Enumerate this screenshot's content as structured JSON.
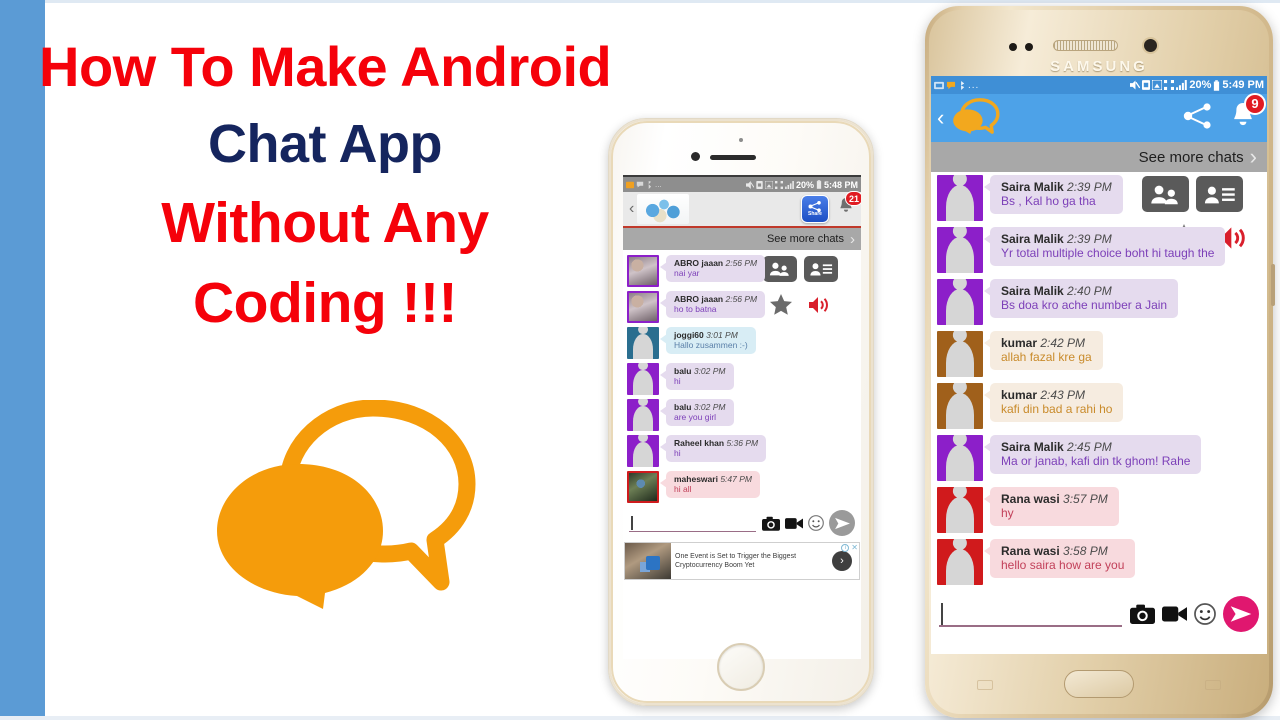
{
  "colors": {
    "accent_blue_bar": "#5b9bd5",
    "title_red": "#f5010a",
    "title_navy": "#15255e",
    "logo_orange": "#f59c0b",
    "appbar_blue": "#4da2e8",
    "badge_red": "#e01b22",
    "seemore_gray": "#a8a8a8",
    "send_pink": "#e0176f"
  },
  "title": {
    "line1": "How To Make Android",
    "line2": "Chat App",
    "line3": "Without Any",
    "line4": "Coding !!!"
  },
  "logo": {
    "icon": "chat-bubbles-icon"
  },
  "iphone": {
    "device_name": "iphone-gold",
    "status_bar": {
      "left_icons": [
        "screenshot-icon",
        "chat-icon",
        "bluetooth-icon",
        "more-icon"
      ],
      "right_icons": [
        "mute-icon",
        "sim-icon",
        "signal-card-icon",
        "wifi-icon",
        "signal-bars-icon",
        "battery-icon"
      ],
      "battery_text": "20%",
      "clock": "5:48 PM"
    },
    "appbar": {
      "back_icon": "back-chevron-icon",
      "logo_icon": "smurfs-avatar-icon",
      "share_label": "Share",
      "share_icon": "share-icon",
      "bell_icon": "bell-icon",
      "bell_badge": "21"
    },
    "see_more": {
      "label": "See more chats",
      "chevron": "chevron-right-icon"
    },
    "overlay": {
      "group_icon": "group-people-icon",
      "contact_icon": "contact-card-icon",
      "star_icon": "star-icon",
      "speaker_icon": "speaker-loud-icon"
    },
    "messages": [
      {
        "name": "ABRO jaaan",
        "time": "2:56 PM",
        "text": "nai yar",
        "theme": "th-purple",
        "avatar": "photo"
      },
      {
        "name": "ABRO jaaan",
        "time": "2:56 PM",
        "text": "ho to batna",
        "theme": "th-purple",
        "avatar": "photo"
      },
      {
        "name": "joggi60",
        "time": "3:01 PM",
        "text": "Hallo zusammen :-)",
        "theme": "th-blue",
        "avatar": "teal"
      },
      {
        "name": "balu",
        "time": "3:02 PM",
        "text": "hi",
        "theme": "th-purple",
        "avatar": "purple"
      },
      {
        "name": "balu",
        "time": "3:02 PM",
        "text": "are you girl",
        "theme": "th-purple",
        "avatar": "purple"
      },
      {
        "name": "Raheel khan",
        "time": "5:36 PM",
        "text": "hi",
        "theme": "th-purple",
        "avatar": "purple"
      },
      {
        "name": "maheswari",
        "time": "5:47 PM",
        "text": "hi all",
        "theme": "th-pink",
        "avatar": "photo2"
      }
    ],
    "composer": {
      "value": "",
      "placeholder": "",
      "camera_icon": "camera-icon",
      "video_icon": "video-camera-icon",
      "emoji_icon": "smiley-icon",
      "send_icon": "send-arrow-icon"
    },
    "ad": {
      "text": "One Event is Set to Trigger the Biggest Cryptocurrency Boom Yet",
      "info_icon": "ad-info-icon",
      "close_icon": "close-icon",
      "cta_icon": "chevron-right-icon"
    }
  },
  "samsung": {
    "device_name": "samsung-galaxy-gold",
    "brand": "SAMSUNG",
    "status_bar": {
      "left_icons": [
        "screenshot-icon",
        "chat-icon",
        "bluetooth-icon",
        "more-icon"
      ],
      "right_icons": [
        "mute-icon",
        "sim-icon",
        "signal-card-icon",
        "wifi-icon",
        "signal-bars-icon",
        "battery-icon"
      ],
      "battery_text": "20%",
      "clock": "5:49 PM"
    },
    "appbar": {
      "back_icon": "back-chevron-icon",
      "logo_icon": "chat-bubbles-icon",
      "share_icon": "share-node-icon",
      "bell_icon": "bell-icon",
      "bell_badge": "9"
    },
    "see_more": {
      "label": "See more chats",
      "chevron": "chevron-right-icon"
    },
    "overlay": {
      "group_icon": "group-people-icon",
      "contact_icon": "contact-card-icon",
      "star_icon": "star-icon",
      "speaker_icon": "speaker-loud-icon"
    },
    "messages": [
      {
        "name": "Saira Malik",
        "time": "2:39 PM",
        "text": "Bs , Kal ho ga tha",
        "theme": "th-purple",
        "avatar": "purple"
      },
      {
        "name": "Saira Malik",
        "time": "2:39 PM",
        "text": "Yr total multiple choice boht hi taugh the",
        "theme": "th-purple",
        "avatar": "purple"
      },
      {
        "name": "Saira Malik",
        "time": "2:40 PM",
        "text": "Bs doa kro ache number a Jain",
        "theme": "th-purple",
        "avatar": "purple"
      },
      {
        "name": "kumar",
        "time": "2:42 PM",
        "text": "allah fazal kre ga",
        "theme": "th-cream",
        "avatar": "brown"
      },
      {
        "name": "kumar",
        "time": "2:43 PM",
        "text": "kafi din bad a rahi ho",
        "theme": "th-cream",
        "avatar": "brown"
      },
      {
        "name": "Saira Malik",
        "time": "2:45 PM",
        "text": "Ma or janab, kafi din tk ghom! Rahe",
        "theme": "th-purple",
        "avatar": "purple"
      },
      {
        "name": "Rana wasi",
        "time": "3:57 PM",
        "text": "hy",
        "theme": "th-pink",
        "avatar": "red"
      },
      {
        "name": "Rana wasi",
        "time": "3:58 PM",
        "text": "hello saira how are you",
        "theme": "th-pink",
        "avatar": "red"
      }
    ],
    "composer": {
      "value": "",
      "placeholder": "",
      "camera_icon": "camera-icon",
      "video_icon": "video-camera-icon",
      "emoji_icon": "smiley-icon",
      "send_icon": "send-arrow-icon"
    }
  }
}
